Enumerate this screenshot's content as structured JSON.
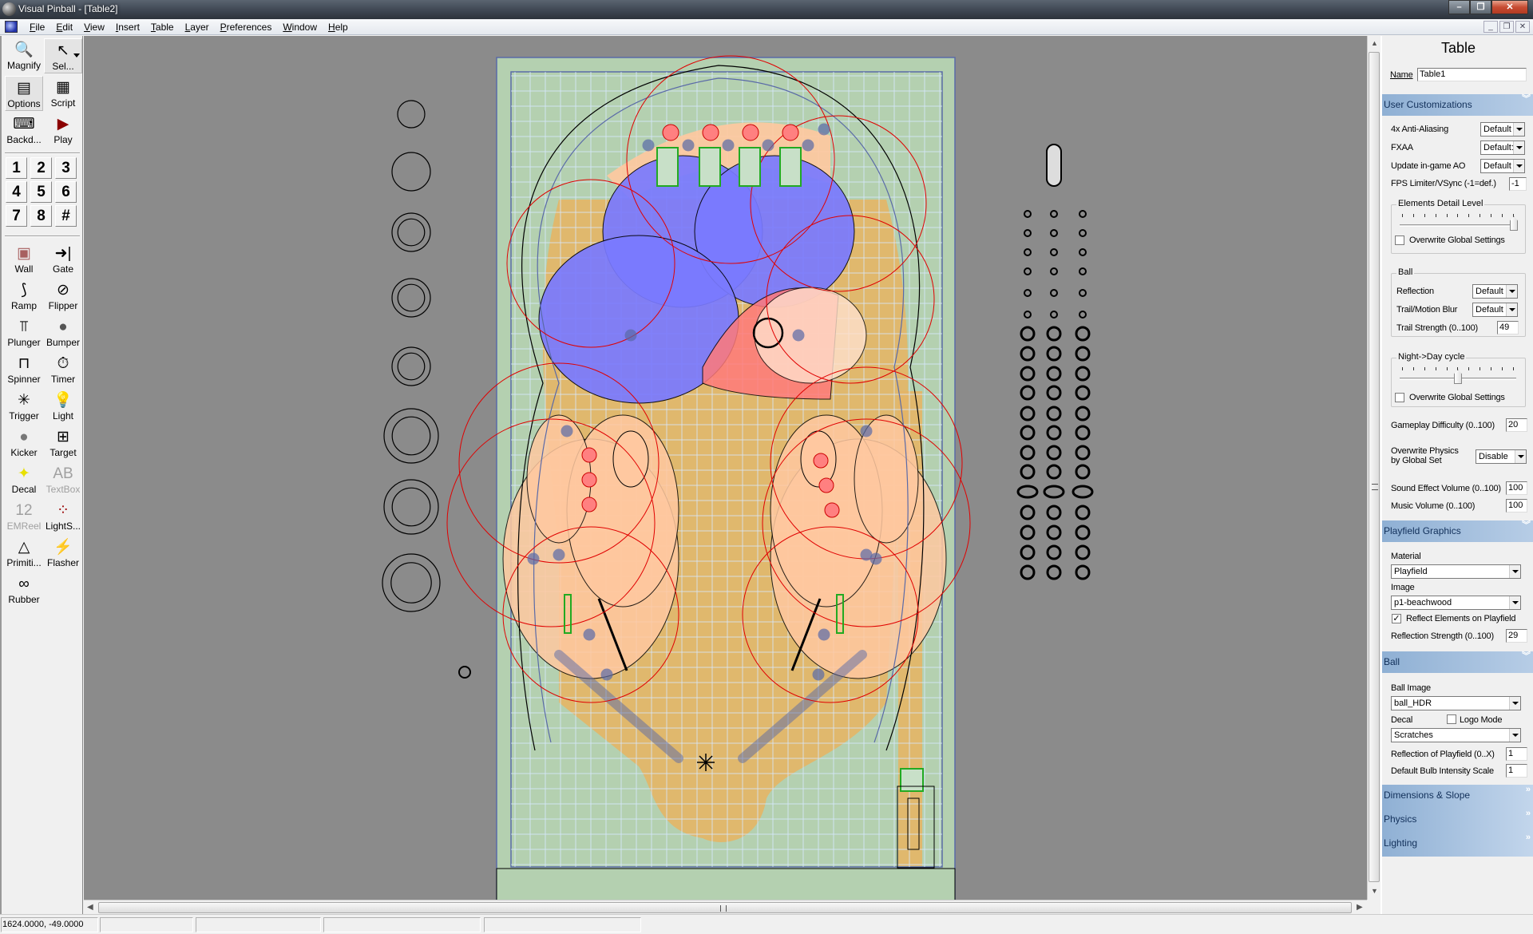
{
  "window": {
    "title": "Visual Pinball - [Table2]",
    "controls": {
      "minimize": "–",
      "maximize": "❐",
      "close": "✕"
    },
    "mdi_controls": {
      "minimize": "_",
      "restore": "❐",
      "close": "✕"
    }
  },
  "menu": {
    "items": [
      "File",
      "Edit",
      "View",
      "Insert",
      "Table",
      "Layer",
      "Preferences",
      "Window",
      "Help"
    ]
  },
  "toolbar": {
    "top_buttons": [
      {
        "label": "Magnify",
        "icon": "magnify-icon",
        "glyph": "🔍"
      },
      {
        "label": "Sel...",
        "icon": "select-arrow-icon",
        "glyph": "↖"
      },
      {
        "label": "Options",
        "icon": "options-icon",
        "glyph": "▤"
      },
      {
        "label": "Script",
        "icon": "script-icon",
        "glyph": "▦"
      },
      {
        "label": "Backd...",
        "icon": "backdrop-icon",
        "glyph": "⌨"
      },
      {
        "label": "Play",
        "icon": "play-icon",
        "glyph": "▶"
      }
    ],
    "layers": [
      "1",
      "2",
      "3",
      "4",
      "5",
      "6",
      "7",
      "8",
      "#"
    ],
    "elements": [
      {
        "label": "Wall",
        "icon": "wall-icon",
        "glyph": "▣",
        "color": "#a86060",
        "enabled": true
      },
      {
        "label": "Gate",
        "icon": "gate-icon",
        "glyph": "➜|",
        "color": "#000000",
        "enabled": true
      },
      {
        "label": "Ramp",
        "icon": "ramp-icon",
        "glyph": "⟆",
        "color": "#000000",
        "enabled": true
      },
      {
        "label": "Flipper",
        "icon": "flipper-icon",
        "glyph": "⊘",
        "color": "#000000",
        "enabled": true
      },
      {
        "label": "Plunger",
        "icon": "plunger-icon",
        "glyph": "⫪",
        "color": "#000000",
        "enabled": true
      },
      {
        "label": "Bumper",
        "icon": "bumper-icon",
        "glyph": "●",
        "color": "#555555",
        "enabled": true
      },
      {
        "label": "Spinner",
        "icon": "spinner-icon",
        "glyph": "⊓",
        "color": "#000000",
        "enabled": true
      },
      {
        "label": "Timer",
        "icon": "timer-icon",
        "glyph": "⏱",
        "color": "#000000",
        "enabled": true
      },
      {
        "label": "Trigger",
        "icon": "trigger-icon",
        "glyph": "✳",
        "color": "#000000",
        "enabled": true
      },
      {
        "label": "Light",
        "icon": "light-bulb-icon",
        "glyph": "💡",
        "color": "#000000",
        "enabled": true
      },
      {
        "label": "Kicker",
        "icon": "kicker-icon",
        "glyph": "●",
        "color": "#777777",
        "enabled": true
      },
      {
        "label": "Target",
        "icon": "target-icon",
        "glyph": "⊞",
        "color": "#000000",
        "enabled": true
      },
      {
        "label": "Decal",
        "icon": "decal-icon",
        "glyph": "✦",
        "color": "#e8e000",
        "enabled": true
      },
      {
        "label": "TextBox",
        "icon": "textbox-icon",
        "glyph": "AB",
        "color": "#a0a0a0",
        "enabled": false
      },
      {
        "label": "EMReel",
        "icon": "emreel-icon",
        "glyph": "12",
        "color": "#a0a0a0",
        "enabled": false
      },
      {
        "label": "LightS...",
        "icon": "light-sequencer-icon",
        "glyph": "⁘",
        "color": "#990000",
        "enabled": true
      },
      {
        "label": "Primiti...",
        "icon": "primitive-icon",
        "glyph": "△",
        "color": "#000000",
        "enabled": true
      },
      {
        "label": "Flasher",
        "icon": "flasher-icon",
        "glyph": "⚡",
        "color": "#000000",
        "enabled": true
      },
      {
        "label": "Rubber",
        "icon": "rubber-icon",
        "glyph": "∞",
        "color": "#000000",
        "enabled": true
      }
    ]
  },
  "editor": {
    "colors": {
      "background": "#8b8b8b",
      "playfield": "#b4d0b0",
      "wood": "#e4b566",
      "grid": "#d8e8ff",
      "peach": "#ffc8a0",
      "ramp_blue": "#7a7aff",
      "ramp_red": "#ff7a7a",
      "outline": "#000000",
      "selection": "#5a6aa8",
      "red_circle": "#e00000",
      "green_target": "#22aa22"
    }
  },
  "panel": {
    "title": "Table",
    "name_label": "Name",
    "name_value": "Table1",
    "sections": {
      "user_customizations": {
        "title": "User Customizations",
        "anti_aliasing": {
          "label": "4x Anti-Aliasing",
          "value": "Default"
        },
        "fxaa": {
          "label": "FXAA",
          "value": "Default:"
        },
        "update_ao": {
          "label": "Update in-game AO",
          "value": "Default"
        },
        "fps_limiter": {
          "label": "FPS Limiter/VSync (-1=def.)",
          "value": "-1"
        },
        "detail_level": {
          "title": "Elements Detail Level",
          "level_fraction": 1.0,
          "overwrite_label": "Overwrite Global Settings",
          "overwrite_checked": false
        },
        "ball": {
          "title": "Ball",
          "reflection": {
            "label": "Reflection",
            "value": "Default"
          },
          "trail_blur": {
            "label": "Trail/Motion Blur",
            "value": "Default"
          },
          "trail_strength": {
            "label": "Trail Strength (0..100)",
            "value": "49"
          }
        },
        "night_day": {
          "title": "Night->Day cycle",
          "level_fraction": 0.5,
          "overwrite_label": "Overwrite Global Settings",
          "overwrite_checked": false
        },
        "difficulty": {
          "label": "Gameplay Difficulty (0..100)",
          "value": "20"
        },
        "overwrite_physics": {
          "label_line1": "Overwrite Physics",
          "label_line2": "by Global Set",
          "value": "Disable"
        },
        "sound_volume": {
          "label": "Sound Effect Volume (0..100)",
          "value": "100"
        },
        "music_volume": {
          "label": "Music Volume (0..100)",
          "value": "100"
        }
      },
      "playfield_graphics": {
        "title": "Playfield Graphics",
        "material_label": "Material",
        "material_value": "Playfield",
        "image_label": "Image",
        "image_value": "p1-beachwood",
        "reflect_label": "Reflect Elements on Playfield",
        "reflect_checked": true,
        "reflection_strength": {
          "label": "Reflection Strength (0..100)",
          "value": "29"
        }
      },
      "ball": {
        "title": "Ball",
        "ball_image_label": "Ball Image",
        "ball_image_value": "ball_HDR",
        "decal_label": "Decal",
        "logo_mode_label": "Logo Mode",
        "logo_mode_checked": false,
        "decal_value": "Scratches",
        "reflection_playfield": {
          "label": "Reflection of Playfield (0..X)",
          "value": "1"
        },
        "bulb_intensity": {
          "label": "Default Bulb Intensity Scale",
          "value": "1"
        }
      },
      "dimensions": {
        "title": "Dimensions & Slope"
      },
      "physics": {
        "title": "Physics"
      },
      "lighting": {
        "title": "Lighting"
      }
    },
    "chevron_expanded": "︾",
    "chevron_collapsed": "»"
  },
  "statusbar": {
    "coordinates": "1624.0000, -49.0000",
    "cells": [
      "",
      "",
      "",
      "",
      ""
    ]
  }
}
